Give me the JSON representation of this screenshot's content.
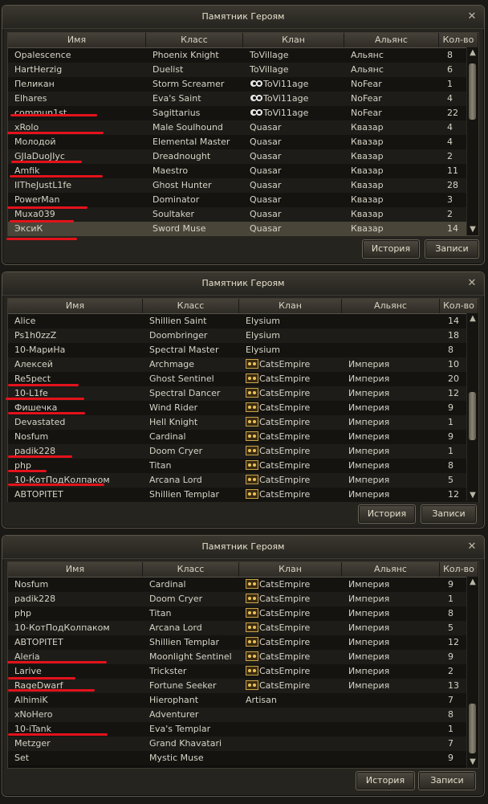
{
  "windows": [
    {
      "title": "Памятник Героям",
      "headers": [
        "Имя",
        "Класс",
        "Клан",
        "Альянс",
        "Кол-во"
      ],
      "history_label": "История",
      "records_label": "Записи",
      "rows": [
        {
          "name": "Opalescence",
          "class": "Phoenix Knight",
          "clan": "ToVillage",
          "ally": "Альянс",
          "count": "8"
        },
        {
          "name": "HartHerzig",
          "class": "Duelist",
          "clan": "ToVillage",
          "ally": "Альянс",
          "count": "6"
        },
        {
          "name": "Пеликан",
          "class": "Storm Screamer",
          "clan": "ToVi11age",
          "ally": "NoFear",
          "count": "1"
        },
        {
          "name": "Elhares",
          "class": "Eva's Saint",
          "clan": "ToVi11age",
          "ally": "NoFear",
          "count": "4"
        },
        {
          "name": "commun1st",
          "class": "Sagittarius",
          "clan": "ToVi11age",
          "ally": "NoFear",
          "count": "22"
        },
        {
          "name": "xRolo",
          "class": "Male Soulhound",
          "clan": "Quasar",
          "ally": "Квазар",
          "count": "4"
        },
        {
          "name": "Молодой",
          "class": "Elemental Master",
          "clan": "Quasar",
          "ally": "Квазар",
          "count": "4"
        },
        {
          "name": "GJIaDuoJIyc",
          "class": "Dreadnought",
          "clan": "Quasar",
          "ally": "Квазар",
          "count": "2"
        },
        {
          "name": "Amfik",
          "class": "Maestro",
          "clan": "Quasar",
          "ally": "Квазар",
          "count": "11"
        },
        {
          "name": "IITheJustL1fe",
          "class": "Ghost Hunter",
          "clan": "Quasar",
          "ally": "Квазар",
          "count": "28"
        },
        {
          "name": "PowerMan",
          "class": "Dominator",
          "clan": "Quasar",
          "ally": "Квазар",
          "count": "3"
        },
        {
          "name": "Muxa039",
          "class": "Soultaker",
          "clan": "Quasar",
          "ally": "Квазар",
          "count": "2"
        },
        {
          "name": "ЭксиК",
          "class": "Sword Muse",
          "clan": "Quasar",
          "ally": "Квазар",
          "count": "14"
        }
      ]
    },
    {
      "title": "Памятник Героям",
      "headers": [
        "Имя",
        "Класс",
        "Клан",
        "Альянс",
        "Кол-во"
      ],
      "history_label": "История",
      "records_label": "Записи",
      "rows": [
        {
          "name": "Alice",
          "class": "Shillien Saint",
          "clan": "Elysium",
          "ally": "",
          "count": "14"
        },
        {
          "name": "Ps1h0zzZ",
          "class": "Doombringer",
          "clan": "Elysium",
          "ally": "",
          "count": "18"
        },
        {
          "name": "10-МариНа",
          "class": "Spectral Master",
          "clan": "Elysium",
          "ally": "",
          "count": "8"
        },
        {
          "name": "Алексей",
          "class": "Archmage",
          "clan": "CatsEmpire",
          "ally": "Империя",
          "count": "10"
        },
        {
          "name": "Re5pect",
          "class": "Ghost Sentinel",
          "clan": "CatsEmpire",
          "ally": "Империя",
          "count": "20"
        },
        {
          "name": "10-L1fe",
          "class": "Spectral Dancer",
          "clan": "CatsEmpire",
          "ally": "Империя",
          "count": "12"
        },
        {
          "name": "Фишечка",
          "class": "Wind Rider",
          "clan": "CatsEmpire",
          "ally": "Империя",
          "count": "9"
        },
        {
          "name": "Devastated",
          "class": "Hell Knight",
          "clan": "CatsEmpire",
          "ally": "Империя",
          "count": "1"
        },
        {
          "name": "Nosfum",
          "class": "Cardinal",
          "clan": "CatsEmpire",
          "ally": "Империя",
          "count": "9"
        },
        {
          "name": "padik228",
          "class": "Doom Cryer",
          "clan": "CatsEmpire",
          "ally": "Империя",
          "count": "1"
        },
        {
          "name": "php",
          "class": "Titan",
          "clan": "CatsEmpire",
          "ally": "Империя",
          "count": "8"
        },
        {
          "name": "10-КотПодКолпаком",
          "class": "Arcana Lord",
          "clan": "CatsEmpire",
          "ally": "Империя",
          "count": "5"
        },
        {
          "name": "АВТОРІТЕТ",
          "class": "Shillien Templar",
          "clan": "CatsEmpire",
          "ally": "Империя",
          "count": "12"
        }
      ]
    },
    {
      "title": "Памятник Героям",
      "headers": [
        "Имя",
        "Класс",
        "Клан",
        "Альянс",
        "Кол-во"
      ],
      "history_label": "История",
      "records_label": "Записи",
      "rows": [
        {
          "name": "Nosfum",
          "class": "Cardinal",
          "clan": "CatsEmpire",
          "ally": "Империя",
          "count": "9"
        },
        {
          "name": "padik228",
          "class": "Doom Cryer",
          "clan": "CatsEmpire",
          "ally": "Империя",
          "count": "1"
        },
        {
          "name": "php",
          "class": "Titan",
          "clan": "CatsEmpire",
          "ally": "Империя",
          "count": "8"
        },
        {
          "name": "10-КотПодКолпаком",
          "class": "Arcana Lord",
          "clan": "CatsEmpire",
          "ally": "Империя",
          "count": "5"
        },
        {
          "name": "АВТОРІТЕТ",
          "class": "Shillien Templar",
          "clan": "CatsEmpire",
          "ally": "Империя",
          "count": "12"
        },
        {
          "name": "Aleria",
          "class": "Moonlight Sentinel",
          "clan": "CatsEmpire",
          "ally": "Империя",
          "count": "9"
        },
        {
          "name": "Larive",
          "class": "Trickster",
          "clan": "CatsEmpire",
          "ally": "Империя",
          "count": "2"
        },
        {
          "name": "RageDwarf",
          "class": "Fortune Seeker",
          "clan": "CatsEmpire",
          "ally": "Империя",
          "count": "13"
        },
        {
          "name": "AlhimiK",
          "class": "Hierophant",
          "clan": "Artisan",
          "ally": "",
          "count": "7"
        },
        {
          "name": "xNoHero",
          "class": "Adventurer",
          "clan": "",
          "ally": "",
          "count": "8"
        },
        {
          "name": "10-iTank",
          "class": "Eva's Templar",
          "clan": "",
          "ally": "",
          "count": "1"
        },
        {
          "name": "Metzger",
          "class": "Grand Khavatari",
          "clan": "",
          "ally": "",
          "count": "7"
        },
        {
          "name": "Set",
          "class": "Mystic Muse",
          "clan": "",
          "ally": "",
          "count": "9"
        }
      ]
    }
  ]
}
